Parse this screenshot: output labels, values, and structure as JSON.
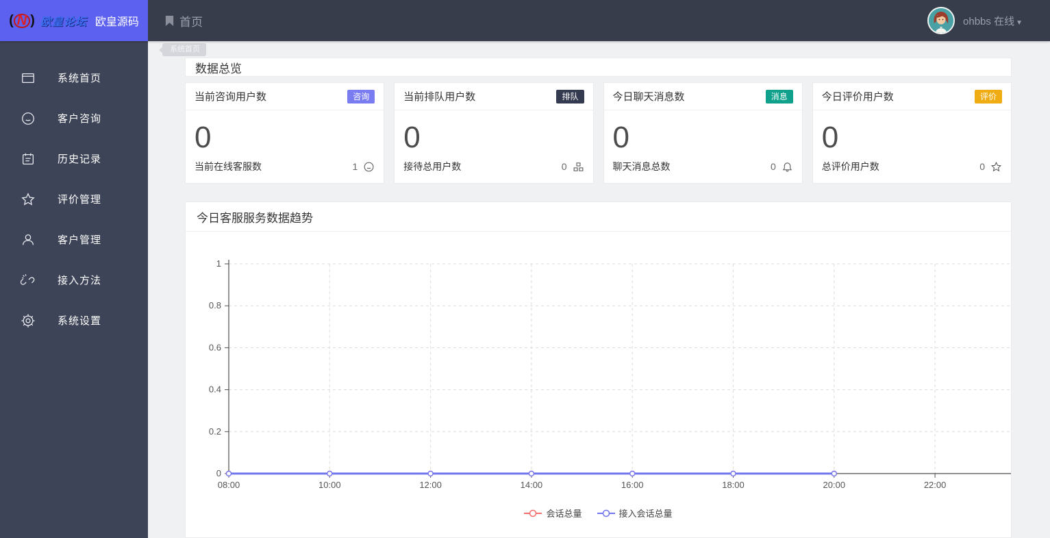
{
  "brand": {
    "logo_mark": "(N)",
    "logo_forum_text": "欧皇论坛",
    "logo_title": "欧皇源码"
  },
  "header": {
    "nav_home": "首页",
    "user_name": "ohbbs",
    "user_status": "在线"
  },
  "sidebar": {
    "items": [
      {
        "label": "系统首页",
        "icon": "window-icon"
      },
      {
        "label": "客户咨询",
        "icon": "smiley-icon"
      },
      {
        "label": "历史记录",
        "icon": "notebook-icon"
      },
      {
        "label": "评价管理",
        "icon": "star-icon"
      },
      {
        "label": "客户管理",
        "icon": "user-icon"
      },
      {
        "label": "接入方法",
        "icon": "broken-link-icon"
      },
      {
        "label": "系统设置",
        "icon": "gear-icon"
      }
    ]
  },
  "tabstrip": {
    "active_tab": "系统首页"
  },
  "overview": {
    "title": "数据总览",
    "cards": [
      {
        "title": "当前咨询用户数",
        "badge": "咨询",
        "badge_color": "#7a7cf2",
        "value": "0",
        "footer_label": "当前在线客服数",
        "footer_value": "1",
        "footer_icon": "smiley-icon"
      },
      {
        "title": "当前排队用户数",
        "badge": "排队",
        "badge_color": "#343a4f",
        "value": "0",
        "footer_label": "接待总用户数",
        "footer_value": "0",
        "footer_icon": "group-icon"
      },
      {
        "title": "今日聊天消息数",
        "badge": "消息",
        "badge_color": "#0fa18c",
        "value": "0",
        "footer_label": "聊天消息总数",
        "footer_value": "0",
        "footer_icon": "bell-icon"
      },
      {
        "title": "今日评价用户数",
        "badge": "评价",
        "badge_color": "#f0ac13",
        "value": "0",
        "footer_label": "总评价用户数",
        "footer_value": "0",
        "footer_icon": "star-icon"
      }
    ]
  },
  "chart_panel": {
    "title": "今日客服服务数据趋势"
  },
  "chart_data": {
    "type": "line",
    "title": "今日客服服务数据趋势",
    "x": [
      "08:00",
      "10:00",
      "12:00",
      "14:00",
      "16:00",
      "18:00",
      "20:00",
      "22:00"
    ],
    "series": [
      {
        "name": "会话总量",
        "color": "#f56c6c",
        "values": [
          0,
          0,
          0,
          0,
          0,
          0,
          0
        ]
      },
      {
        "name": "接入会话总量",
        "color": "#7276ee",
        "values": [
          0,
          0,
          0,
          0,
          0,
          0,
          0
        ]
      }
    ],
    "data_through": "20:00",
    "ylim": [
      0,
      1
    ],
    "yticks": [
      0,
      0.2,
      0.4,
      0.6,
      0.8,
      1
    ],
    "grid": "dashed",
    "legend_position": "bottom",
    "axis_color": "#4d4d4d",
    "grid_color": "#dcdcdc",
    "label_color": "#555555"
  }
}
